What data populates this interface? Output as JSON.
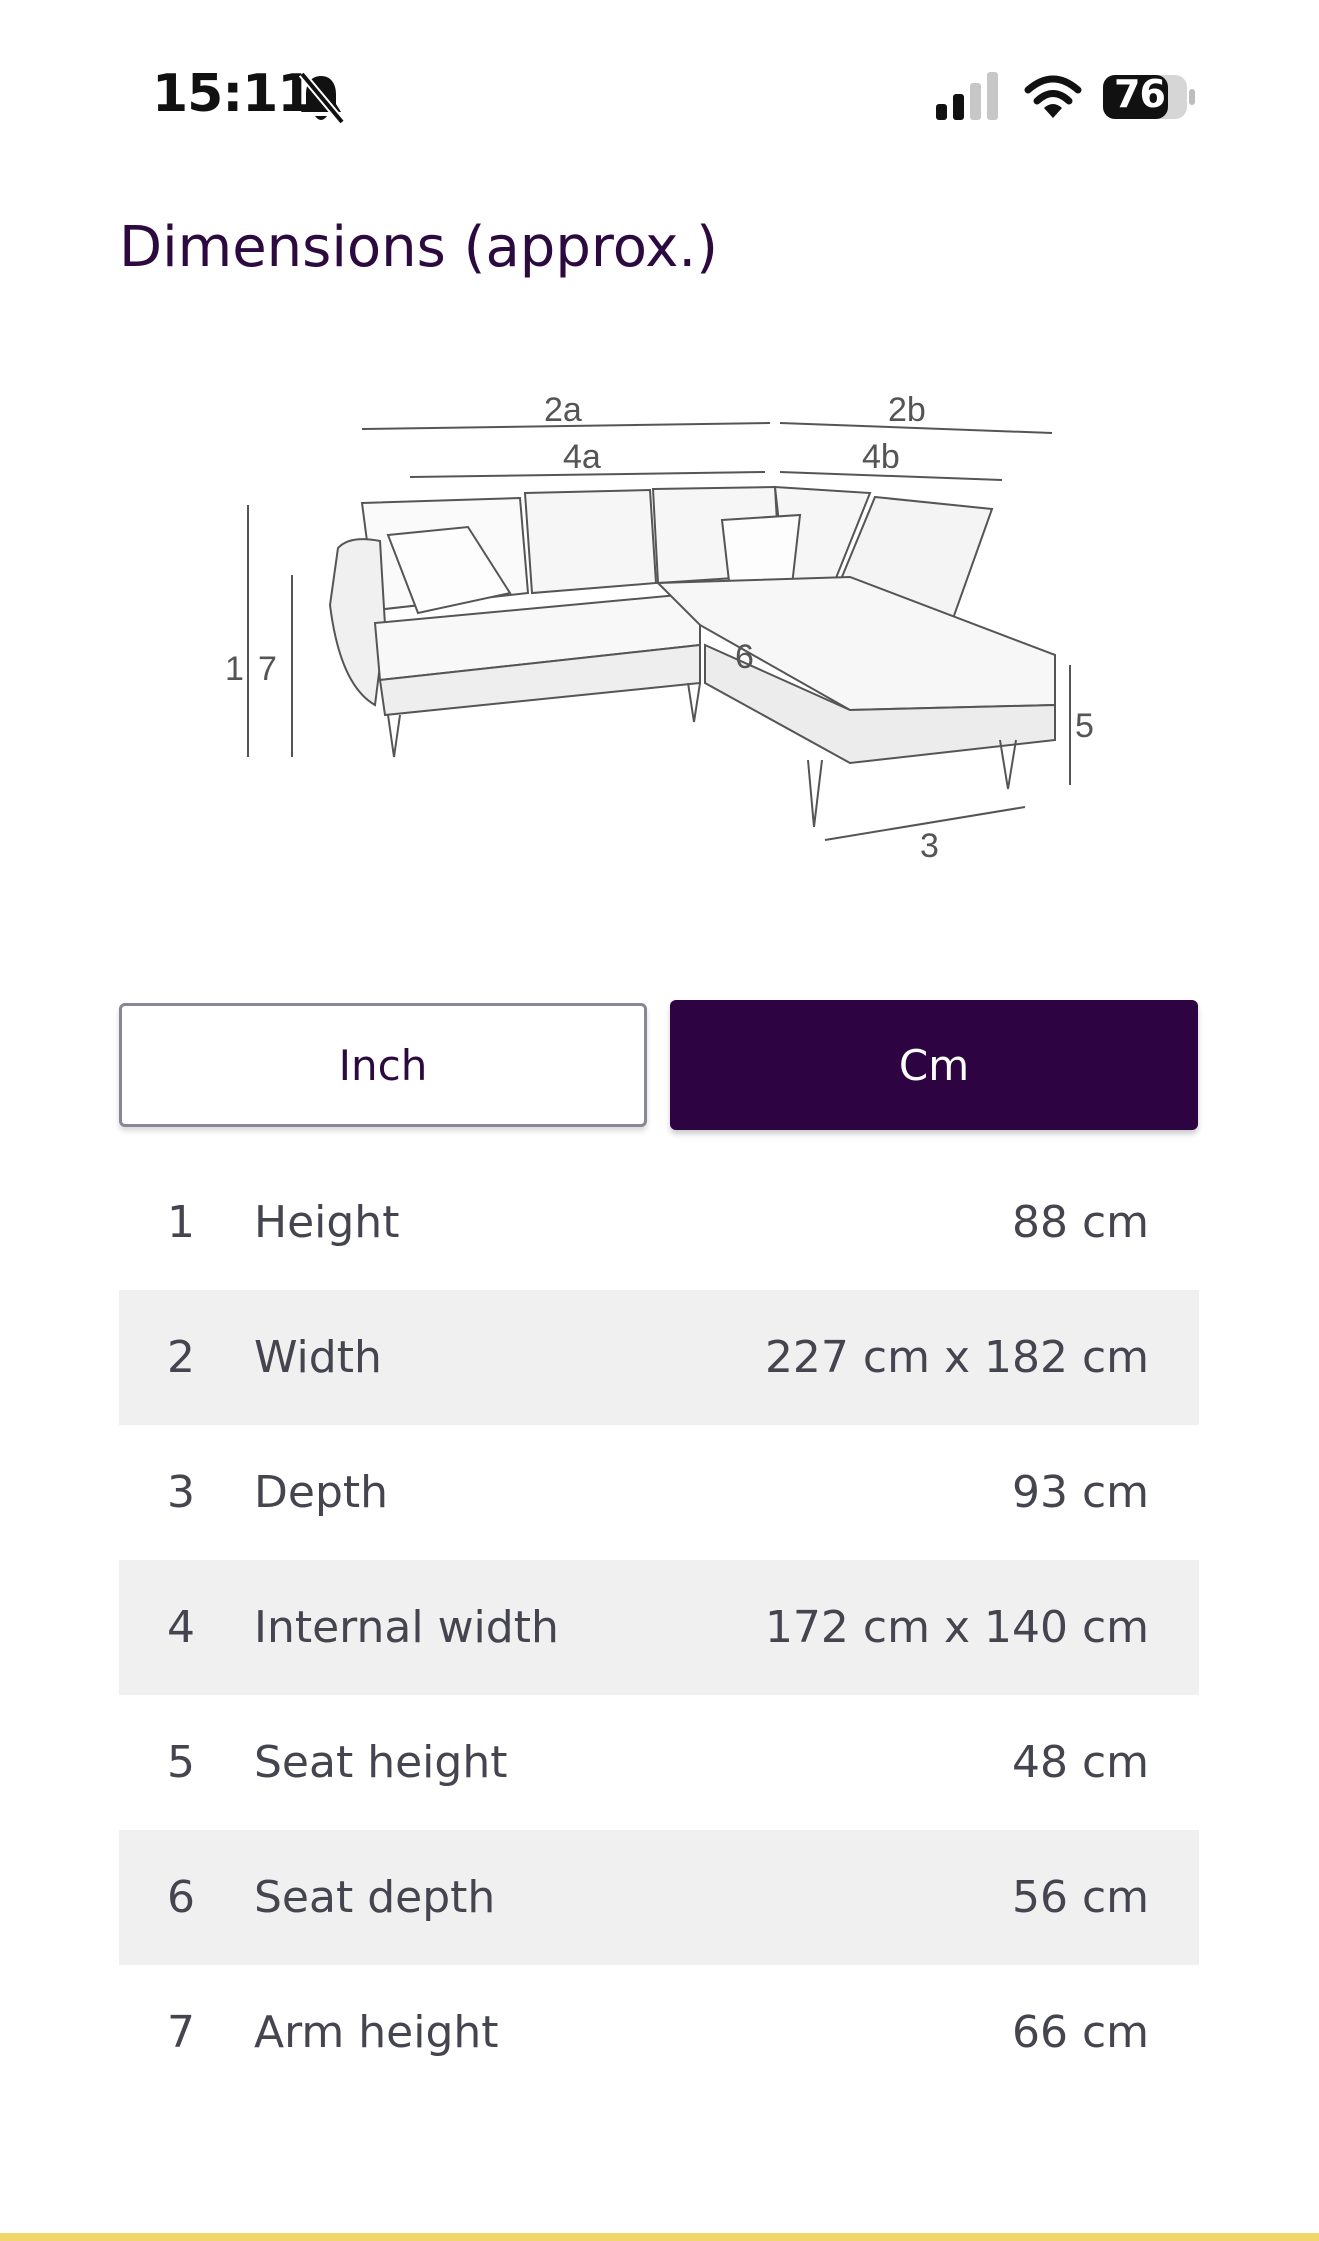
{
  "status_bar": {
    "time": "15:11",
    "battery": "76",
    "icons": [
      "bell-slash-icon",
      "cellular-signal-icon",
      "wifi-icon",
      "battery-icon"
    ]
  },
  "page": {
    "title": "Dimensions (approx.)"
  },
  "diagram": {
    "labels": [
      "2a",
      "2b",
      "4a",
      "4b",
      "1",
      "7",
      "6",
      "5",
      "3"
    ]
  },
  "unit_toggle": {
    "options": [
      {
        "label": "Inch",
        "selected": false
      },
      {
        "label": "Cm",
        "selected": true
      }
    ]
  },
  "dimensions": [
    {
      "num": "1",
      "label": "Height",
      "value": "88 cm"
    },
    {
      "num": "2",
      "label": "Width",
      "value": "227 cm x 182 cm"
    },
    {
      "num": "3",
      "label": "Depth",
      "value": "93 cm"
    },
    {
      "num": "4",
      "label": "Internal width",
      "value": "172 cm x 140 cm"
    },
    {
      "num": "5",
      "label": "Seat height",
      "value": "48 cm"
    },
    {
      "num": "6",
      "label": "Seat depth",
      "value": "56 cm"
    },
    {
      "num": "7",
      "label": "Arm height",
      "value": "66 cm"
    }
  ],
  "colors": {
    "accent": "#2d0342",
    "title": "#2c0a40",
    "row_alt": "#f0f0f1",
    "bottom_bar": "#f1d76a"
  }
}
